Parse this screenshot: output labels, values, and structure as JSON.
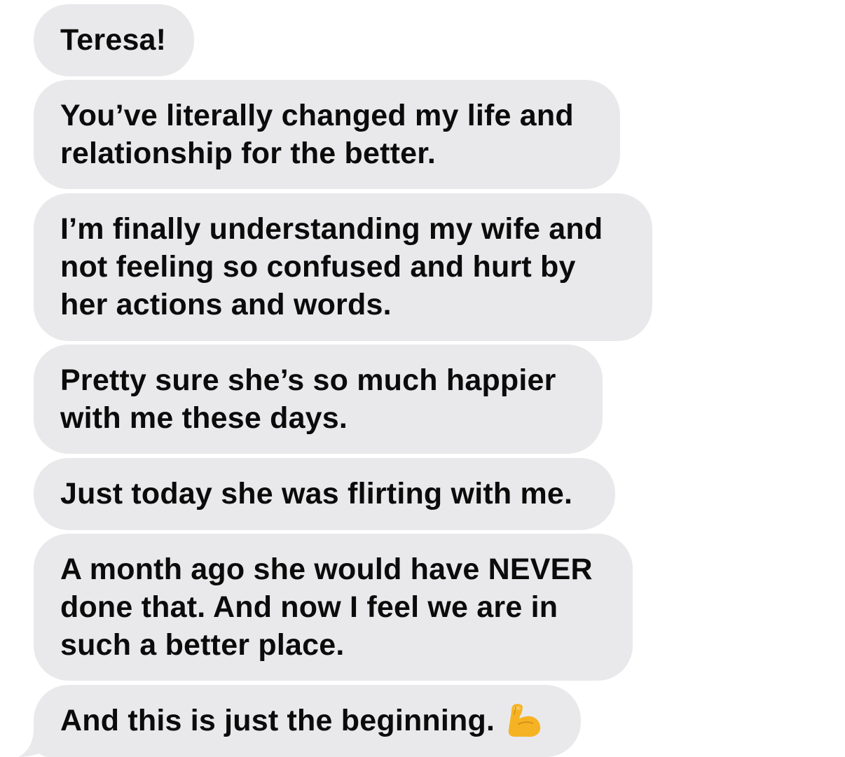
{
  "messages": [
    {
      "lines": [
        "Teresa!"
      ]
    },
    {
      "lines": [
        "You’ve literally changed my life and",
        "relationship for the better."
      ]
    },
    {
      "lines": [
        "I’m finally understanding my wife and",
        "not feeling so confused and hurt by",
        "her actions and words."
      ]
    },
    {
      "lines": [
        "Pretty sure she’s so much happier",
        "with me these days."
      ]
    },
    {
      "lines": [
        "Just today she was flirting with me."
      ]
    },
    {
      "lines": [
        "A month ago she would have NEVER",
        "done that. And now I feel we are in",
        "such a better place."
      ]
    },
    {
      "lines": [
        "And this is just the beginning."
      ],
      "emoji": "flexed-biceps-icon"
    }
  ],
  "colors": {
    "bubble": "#e9e9eb",
    "text": "#0b0b0b",
    "background": "#ffffff",
    "emoji": "#f5b323"
  }
}
